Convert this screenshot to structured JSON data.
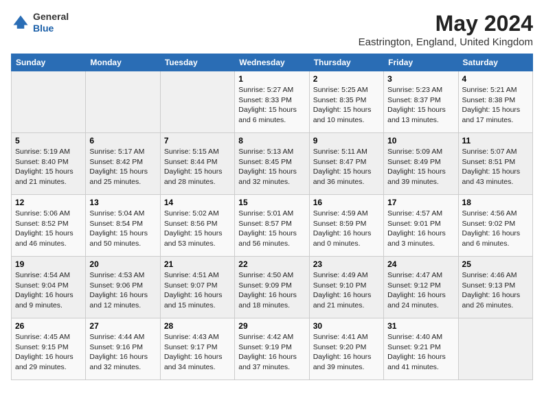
{
  "header": {
    "logo_general": "General",
    "logo_blue": "Blue",
    "month_year": "May 2024",
    "location": "Eastrington, England, United Kingdom"
  },
  "weekdays": [
    "Sunday",
    "Monday",
    "Tuesday",
    "Wednesday",
    "Thursday",
    "Friday",
    "Saturday"
  ],
  "weeks": [
    [
      {
        "day": "",
        "info": ""
      },
      {
        "day": "",
        "info": ""
      },
      {
        "day": "",
        "info": ""
      },
      {
        "day": "1",
        "info": "Sunrise: 5:27 AM\nSunset: 8:33 PM\nDaylight: 15 hours\nand 6 minutes."
      },
      {
        "day": "2",
        "info": "Sunrise: 5:25 AM\nSunset: 8:35 PM\nDaylight: 15 hours\nand 10 minutes."
      },
      {
        "day": "3",
        "info": "Sunrise: 5:23 AM\nSunset: 8:37 PM\nDaylight: 15 hours\nand 13 minutes."
      },
      {
        "day": "4",
        "info": "Sunrise: 5:21 AM\nSunset: 8:38 PM\nDaylight: 15 hours\nand 17 minutes."
      }
    ],
    [
      {
        "day": "5",
        "info": "Sunrise: 5:19 AM\nSunset: 8:40 PM\nDaylight: 15 hours\nand 21 minutes."
      },
      {
        "day": "6",
        "info": "Sunrise: 5:17 AM\nSunset: 8:42 PM\nDaylight: 15 hours\nand 25 minutes."
      },
      {
        "day": "7",
        "info": "Sunrise: 5:15 AM\nSunset: 8:44 PM\nDaylight: 15 hours\nand 28 minutes."
      },
      {
        "day": "8",
        "info": "Sunrise: 5:13 AM\nSunset: 8:45 PM\nDaylight: 15 hours\nand 32 minutes."
      },
      {
        "day": "9",
        "info": "Sunrise: 5:11 AM\nSunset: 8:47 PM\nDaylight: 15 hours\nand 36 minutes."
      },
      {
        "day": "10",
        "info": "Sunrise: 5:09 AM\nSunset: 8:49 PM\nDaylight: 15 hours\nand 39 minutes."
      },
      {
        "day": "11",
        "info": "Sunrise: 5:07 AM\nSunset: 8:51 PM\nDaylight: 15 hours\nand 43 minutes."
      }
    ],
    [
      {
        "day": "12",
        "info": "Sunrise: 5:06 AM\nSunset: 8:52 PM\nDaylight: 15 hours\nand 46 minutes."
      },
      {
        "day": "13",
        "info": "Sunrise: 5:04 AM\nSunset: 8:54 PM\nDaylight: 15 hours\nand 50 minutes."
      },
      {
        "day": "14",
        "info": "Sunrise: 5:02 AM\nSunset: 8:56 PM\nDaylight: 15 hours\nand 53 minutes."
      },
      {
        "day": "15",
        "info": "Sunrise: 5:01 AM\nSunset: 8:57 PM\nDaylight: 15 hours\nand 56 minutes."
      },
      {
        "day": "16",
        "info": "Sunrise: 4:59 AM\nSunset: 8:59 PM\nDaylight: 16 hours\nand 0 minutes."
      },
      {
        "day": "17",
        "info": "Sunrise: 4:57 AM\nSunset: 9:01 PM\nDaylight: 16 hours\nand 3 minutes."
      },
      {
        "day": "18",
        "info": "Sunrise: 4:56 AM\nSunset: 9:02 PM\nDaylight: 16 hours\nand 6 minutes."
      }
    ],
    [
      {
        "day": "19",
        "info": "Sunrise: 4:54 AM\nSunset: 9:04 PM\nDaylight: 16 hours\nand 9 minutes."
      },
      {
        "day": "20",
        "info": "Sunrise: 4:53 AM\nSunset: 9:06 PM\nDaylight: 16 hours\nand 12 minutes."
      },
      {
        "day": "21",
        "info": "Sunrise: 4:51 AM\nSunset: 9:07 PM\nDaylight: 16 hours\nand 15 minutes."
      },
      {
        "day": "22",
        "info": "Sunrise: 4:50 AM\nSunset: 9:09 PM\nDaylight: 16 hours\nand 18 minutes."
      },
      {
        "day": "23",
        "info": "Sunrise: 4:49 AM\nSunset: 9:10 PM\nDaylight: 16 hours\nand 21 minutes."
      },
      {
        "day": "24",
        "info": "Sunrise: 4:47 AM\nSunset: 9:12 PM\nDaylight: 16 hours\nand 24 minutes."
      },
      {
        "day": "25",
        "info": "Sunrise: 4:46 AM\nSunset: 9:13 PM\nDaylight: 16 hours\nand 26 minutes."
      }
    ],
    [
      {
        "day": "26",
        "info": "Sunrise: 4:45 AM\nSunset: 9:15 PM\nDaylight: 16 hours\nand 29 minutes."
      },
      {
        "day": "27",
        "info": "Sunrise: 4:44 AM\nSunset: 9:16 PM\nDaylight: 16 hours\nand 32 minutes."
      },
      {
        "day": "28",
        "info": "Sunrise: 4:43 AM\nSunset: 9:17 PM\nDaylight: 16 hours\nand 34 minutes."
      },
      {
        "day": "29",
        "info": "Sunrise: 4:42 AM\nSunset: 9:19 PM\nDaylight: 16 hours\nand 37 minutes."
      },
      {
        "day": "30",
        "info": "Sunrise: 4:41 AM\nSunset: 9:20 PM\nDaylight: 16 hours\nand 39 minutes."
      },
      {
        "day": "31",
        "info": "Sunrise: 4:40 AM\nSunset: 9:21 PM\nDaylight: 16 hours\nand 41 minutes."
      },
      {
        "day": "",
        "info": ""
      }
    ]
  ]
}
